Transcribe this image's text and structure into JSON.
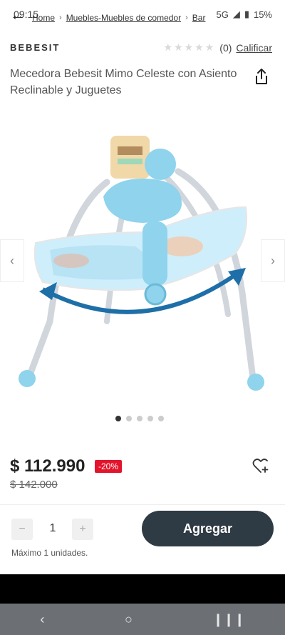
{
  "status": {
    "time": "09:15",
    "battery": "15%",
    "network": "5G"
  },
  "breadcrumb": {
    "items": [
      "Home",
      "Muebles-Muebles de comedor",
      "Bar"
    ]
  },
  "product": {
    "brand": "BEBESIT",
    "rating_count": "(0)",
    "rate_label": "Calificar",
    "stars": "★★★★★",
    "title": "Mecedora Bebesit Mimo Celeste con Asiento Reclinable y Juguetes",
    "price": "$ 112.990",
    "discount": "-20%",
    "old_price": "$ 142.000"
  },
  "gallery": {
    "image_label": "bebesit",
    "current_index": 1,
    "total": 5
  },
  "cart": {
    "quantity": "1",
    "minus": "−",
    "plus": "+",
    "add_label": "Agregar",
    "max_note": "Máximo 1 unidades."
  },
  "colors": {
    "add_button": "#2e3a44",
    "discount_badge": "#e3152c"
  }
}
